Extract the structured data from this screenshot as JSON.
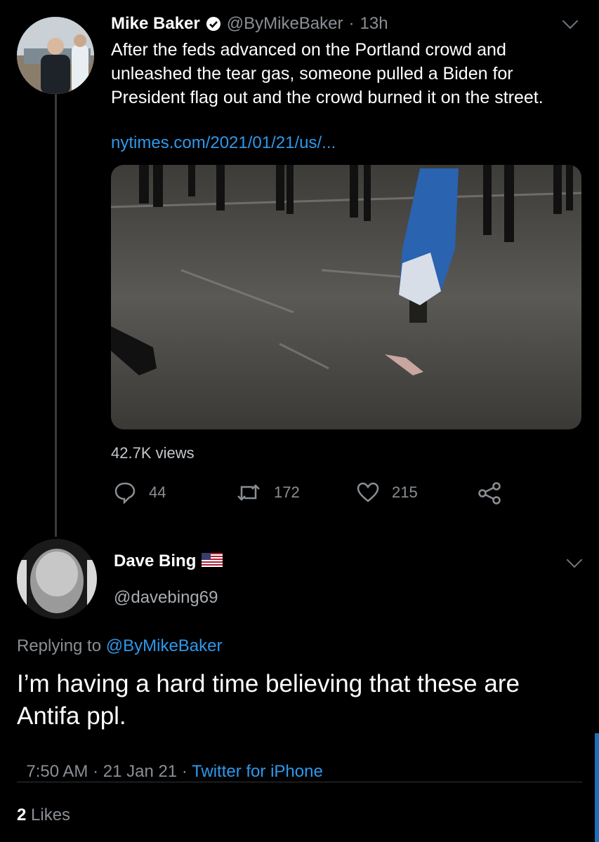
{
  "tweet": {
    "author_name": "Mike Baker",
    "handle": "@ByMikeBaker",
    "time": "13h",
    "text": "After the feds advanced on the Portland crowd and unleashed the tear gas, someone pulled a Biden for President flag out and the crowd burned it on the street.",
    "link": "nytimes.com/2021/01/21/us/...",
    "views": "42.7K views",
    "replies": "44",
    "retweets": "172",
    "likes": "215"
  },
  "reply": {
    "author_name": "Dave Bing",
    "handle": "@davebing69",
    "replying_prefix": "Replying to",
    "replying_to": "@ByMikeBaker",
    "text": "I’m having a hard time believing that these are Antifa ppl.",
    "timestamp": "7:50 AM · 21 Jan 21 · ",
    "source": "Twitter for iPhone",
    "likes_count": "2",
    "likes_label": "Likes"
  },
  "colors": {
    "background": "#000000",
    "link": "#2f98ea",
    "muted": "#8a8f95"
  }
}
